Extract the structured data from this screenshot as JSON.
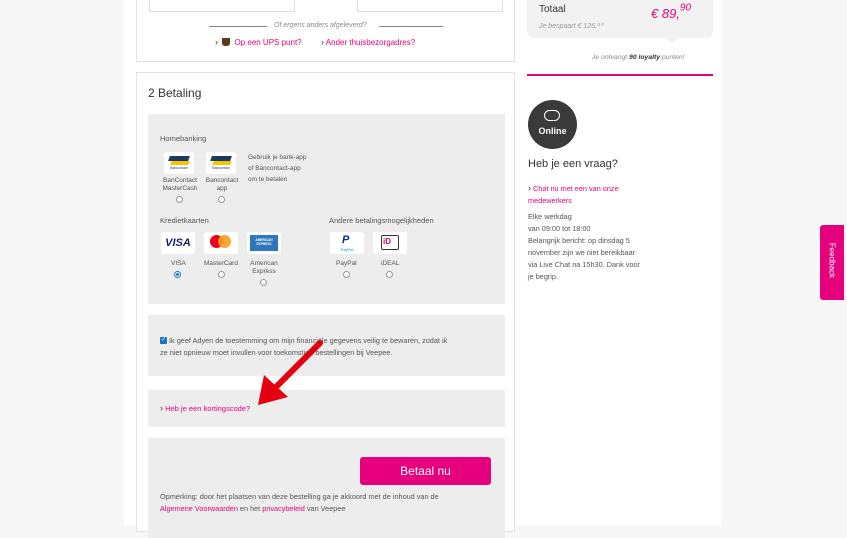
{
  "delivery": {
    "alt_delivery_text": "Of ergens anders afgeleverd?",
    "ups_link": "Op een UPS punt?",
    "other_address_link": "Ander thuisbezorgadres?"
  },
  "payment": {
    "section_title": "2 Betaling",
    "homebanking_label": "Homebanking",
    "homebanking_options": [
      {
        "label": "BanContact MasterCash",
        "logo": "Bancontact"
      },
      {
        "label": "Bancontact app",
        "logo": "Bancontact"
      }
    ],
    "homebanking_note": "Gebruik je bank-app of Bancontact-app om te betalen",
    "creditcards_label": "Kredietkaarten",
    "creditcards": [
      {
        "label": "VISA",
        "logo": "VISA",
        "selected": true
      },
      {
        "label": "MasterCard",
        "logo": "mastercard-logo",
        "selected": false
      },
      {
        "label": "American Express",
        "logo": "AMERICAN EXPRESS",
        "selected": false
      }
    ],
    "other_methods_label": "Andere betalingsmogelijkheden",
    "other_methods": [
      {
        "label": "PayPal",
        "logo": "PayPal"
      },
      {
        "label": "iDEAL",
        "logo": "iD"
      }
    ],
    "consent_text_line1": "Ik geef Adyen de toestemming om mijn financiële gegevens veilig te bewaren, zodat ik",
    "consent_text_line2": "ze niet opnieuw moet invullen voor toekomstige bestellingen bij Veepee.",
    "consent_checked": true,
    "discount_link": "Heb je een kortingscode?",
    "pay_button": "Betaal nu",
    "remark_line1": "Opmerking: door het plaatsen van deze bestelling ga je akkoord met de inhoud van de",
    "terms_link": "Algemene Voorwaarden",
    "remark_and": "en het",
    "privacy_link": "privacybeleid",
    "remark_end": "van Veepee"
  },
  "summary": {
    "total_label": "Totaal",
    "saved_text": "Je bespaart € 126,⁹⁰",
    "total_price_main": "€ 89,",
    "total_price_cents": "90",
    "loyalty_prefix": "Je ontvangt",
    "loyalty_points": "90 loyalty",
    "loyalty_suffix": "punten!"
  },
  "help": {
    "online_badge": "Online",
    "question_title": "Heb je een vraag?",
    "chat_link_line1": "Chat nu met een van onze",
    "chat_link_line2": "medewerkers",
    "hours_lines": [
      "Elke werkdag",
      "van 09:00 tot 18:00",
      "Belangrijk bericht: op dinsdag 5",
      "november zijn we niet bereikbaar",
      "via Live Chat na 15h30. Dank voor",
      "je begrip."
    ]
  },
  "feedback_tab": "Feedback",
  "colors": {
    "accent": "#e6007e",
    "online_badge": "#3a3a3a",
    "arrow": "#e3000f"
  }
}
